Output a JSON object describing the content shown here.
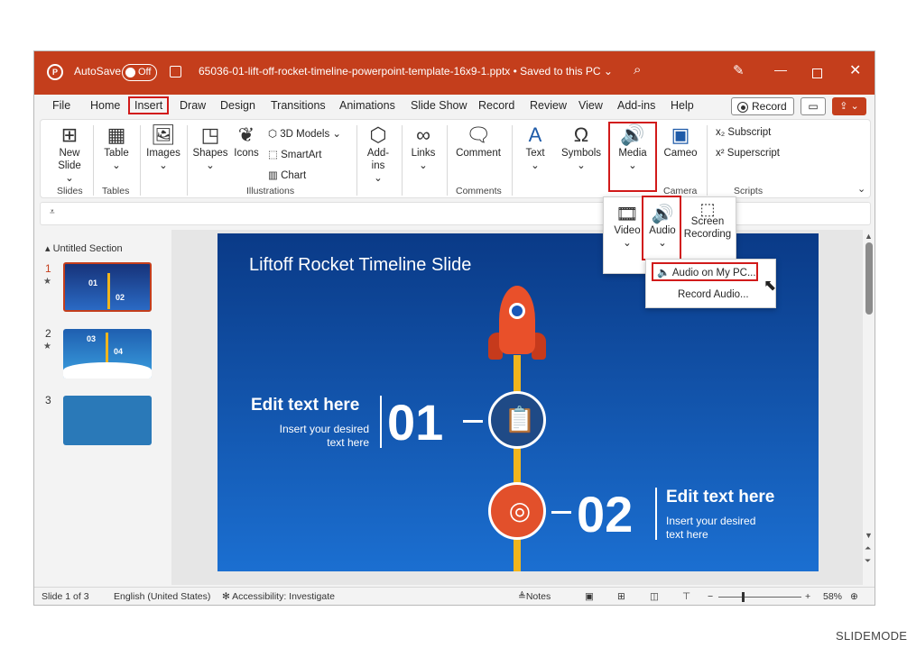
{
  "titlebar": {
    "autosave_label": "AutoSave",
    "autosave_state": "Off",
    "filename": "65036-01-lift-off-rocket-timeline-powerpoint-template-16x9-1.pptx • Saved to this PC",
    "chevron": "⌄",
    "search_icon": "⌕",
    "pen_icon": "✎",
    "minimize": "—",
    "close": "✕",
    "brand_color": "#c43e1c"
  },
  "menu": {
    "items": [
      "File",
      "Home",
      "Insert",
      "Draw",
      "Design",
      "Transitions",
      "Animations",
      "Slide Show",
      "Record",
      "Review",
      "View",
      "Add-ins",
      "Help"
    ],
    "active": "Insert",
    "record_label": "Record",
    "comment_icon": "▭",
    "share_icon": "⇪ ⌄"
  },
  "ribbon": {
    "new_slide": "New Slide",
    "table": "Table",
    "images": "Images",
    "shapes": "Shapes",
    "icons": "Icons",
    "models3d": "3D Models",
    "smartart": "SmartArt",
    "chart": "Chart",
    "addins": "Add-ins",
    "links": "Links",
    "comment": "Comment",
    "text": "Text",
    "symbols": "Symbols",
    "media": "Media",
    "cameo": "Cameo",
    "subscript": "Subscript",
    "superscript": "Superscript",
    "groups": {
      "slides": "Slides",
      "tables": "Tables",
      "illustrations": "Illustrations",
      "comments": "Comments",
      "camera": "Camera",
      "scripts": "Scripts"
    },
    "dropdown_arrow": "⌄",
    "collapse_icon": "⌄"
  },
  "qat": {
    "icon": "⩡"
  },
  "thumbs": {
    "section": "Untitled Section",
    "slides": [
      {
        "num": "1",
        "star": "★"
      },
      {
        "num": "2",
        "star": "★"
      },
      {
        "num": "3",
        "star": ""
      }
    ],
    "t1_nums": [
      "01",
      "02"
    ],
    "t2_nums": [
      "03",
      "04"
    ]
  },
  "slide": {
    "title": "Liftoff Rocket Timeline Slide",
    "item1": {
      "num": "01",
      "heading": "Edit text here",
      "sub1": "Insert your desired",
      "sub2": "text here"
    },
    "item2": {
      "num": "02",
      "heading": "Edit text here",
      "sub1": "Insert your desired",
      "sub2": "text here"
    },
    "clipboard_icon": "📋",
    "target_icon": "◎"
  },
  "media_menu": {
    "video": "Video",
    "audio": "Audio",
    "screen_recording": "Screen Recording"
  },
  "audio_menu": {
    "audio_on_pc": "Audio on My PC...",
    "record_audio": "Record Audio..."
  },
  "status": {
    "slide_of": "Slide 1 of 3",
    "language": "English (United States)",
    "accessibility": "Accessibility: Investigate",
    "notes": "Notes",
    "zoom": "58%",
    "minus": "−",
    "plus": "+"
  },
  "watermark": "SLIDEMODEL"
}
